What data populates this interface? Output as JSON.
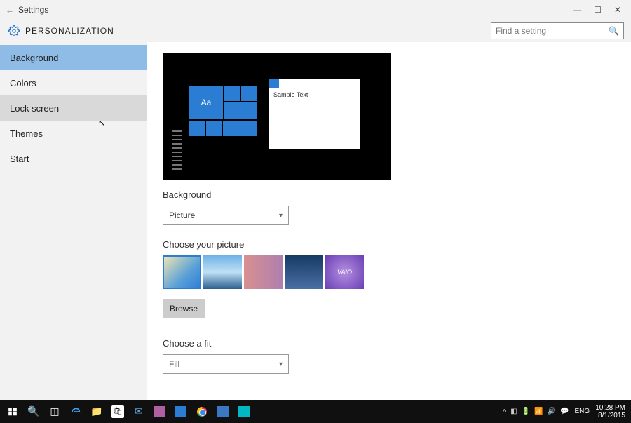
{
  "titlebar": {
    "back_glyph": "←",
    "title": "Settings"
  },
  "header": {
    "crumb": "PERSONALIZATION"
  },
  "search": {
    "placeholder": "Find a setting"
  },
  "sidebar": {
    "items": [
      {
        "label": "Background",
        "state": "active"
      },
      {
        "label": "Colors",
        "state": ""
      },
      {
        "label": "Lock screen",
        "state": "hover"
      },
      {
        "label": "Themes",
        "state": ""
      },
      {
        "label": "Start",
        "state": ""
      }
    ]
  },
  "preview": {
    "tile_text": "Aa",
    "sample_text": "Sample Text"
  },
  "sections": {
    "background_label": "Background",
    "background_value": "Picture",
    "choose_picture_label": "Choose your picture",
    "browse_label": "Browse",
    "choose_fit_label": "Choose a fit",
    "fit_value": "Fill"
  },
  "thumbs": [
    {
      "name": "windows-hero",
      "selected": true
    },
    {
      "name": "beach",
      "selected": false
    },
    {
      "name": "portrait-1",
      "selected": false
    },
    {
      "name": "portrait-2",
      "selected": false
    },
    {
      "name": "vaio-purple",
      "selected": false
    }
  ],
  "taskbar": {
    "lang": "ENG",
    "time": "10:28 PM",
    "date": "8/1/2015"
  }
}
